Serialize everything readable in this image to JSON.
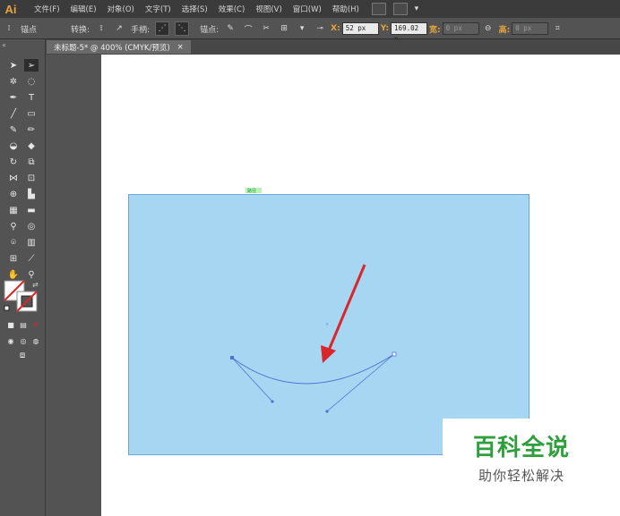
{
  "app": {
    "logo": "Ai"
  },
  "menu": [
    "文件(F)",
    "编辑(E)",
    "对象(O)",
    "文字(T)",
    "选择(S)",
    "效果(C)",
    "视图(V)",
    "窗口(W)",
    "帮助(H)"
  ],
  "control_bar": {
    "selection_label": "锚点",
    "convert_label": "转换:",
    "handles_label": "手柄:",
    "anchors_label": "锚点:",
    "x_label": "X:",
    "x_value": "52 px",
    "y_label": "Y:",
    "y_value": "169.02 p",
    "w_label": "宽:",
    "w_value": "0 px",
    "h_label": "高:",
    "h_value": "0 px"
  },
  "tab": {
    "title": "未标题-5* @ 400% (CMYK/预览)",
    "close": "×"
  },
  "toolbox": {
    "collapse": "«"
  },
  "canvas": {
    "shape_color": "#a6d6f2",
    "path_color": "#4a73d6",
    "arrow_color": "#d9262b",
    "anchor_label": "路径"
  },
  "watermark": {
    "title": "百科全说",
    "subtitle": "助你轻松解决"
  }
}
